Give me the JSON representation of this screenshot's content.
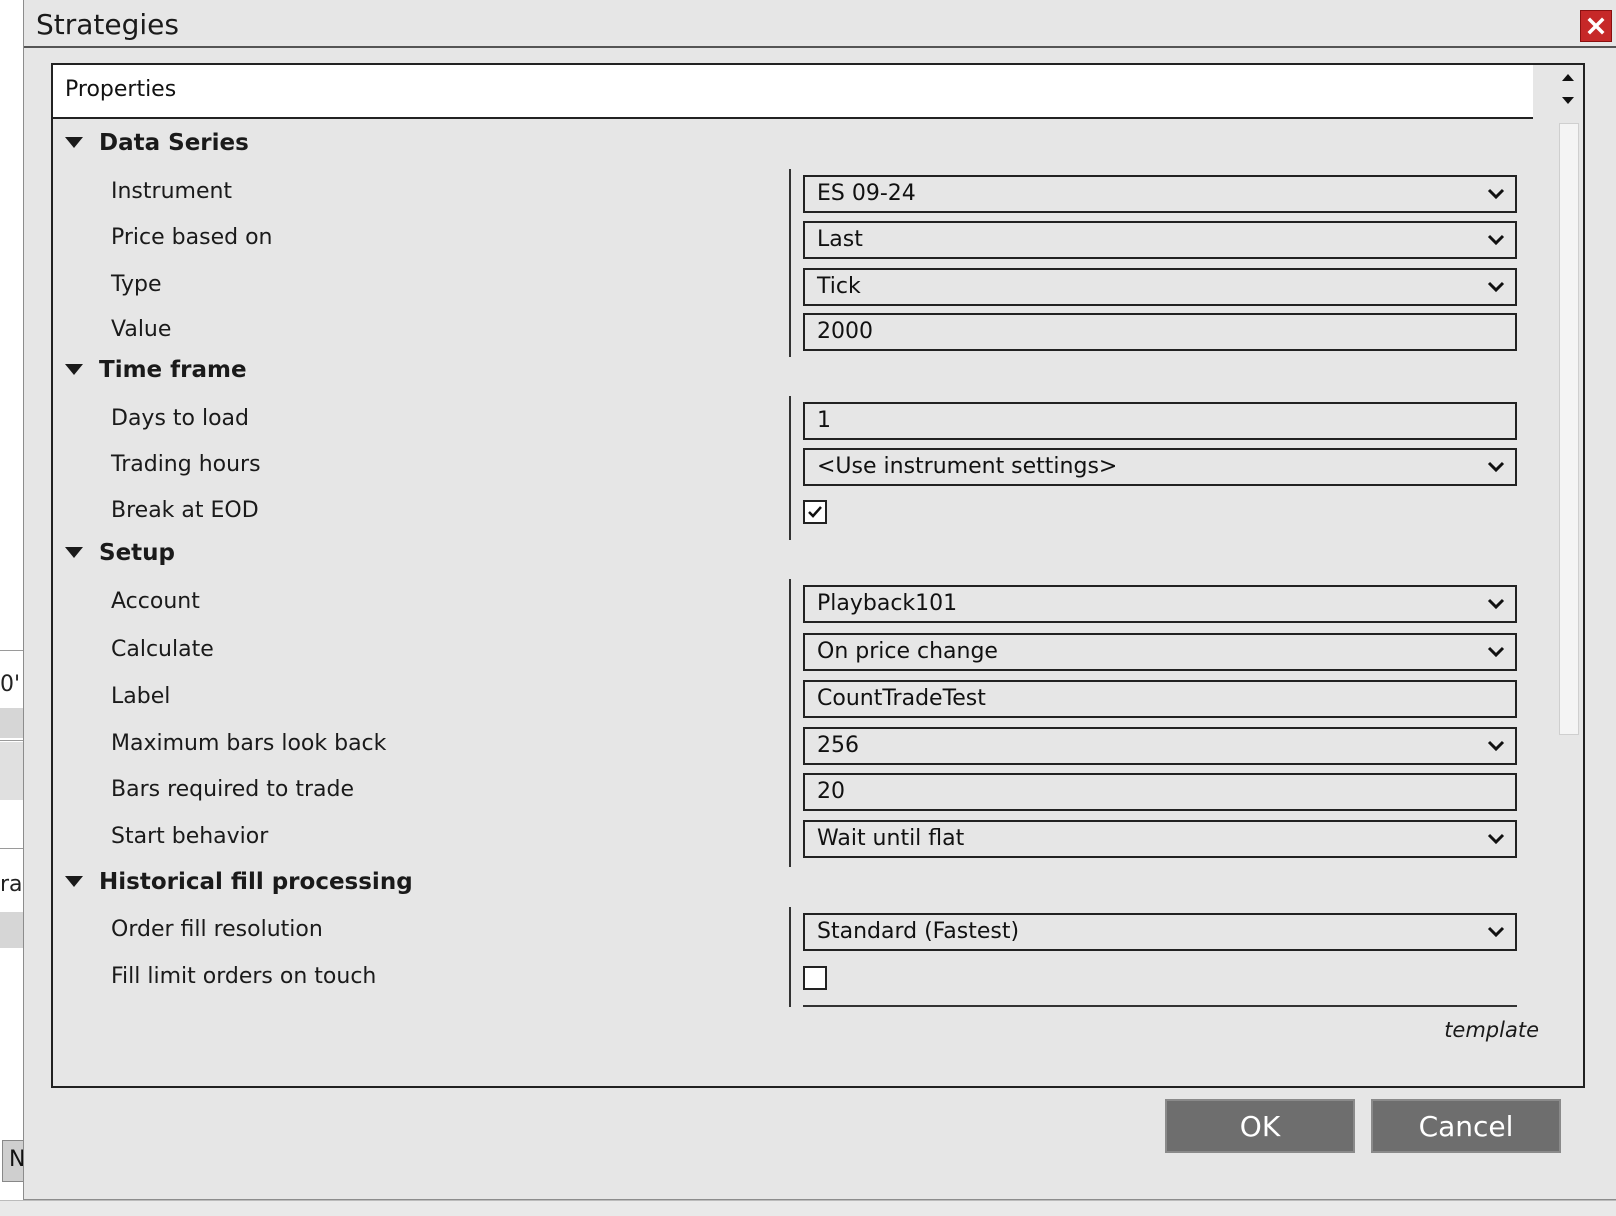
{
  "background": {
    "fragment_1": "0'",
    "fragment_2": "ra",
    "fragment_3": "N"
  },
  "dialog": {
    "title": "Strategies",
    "close_icon": "close-icon",
    "accent_close": "#c62828"
  },
  "properties": {
    "header": "Properties",
    "groups": [
      {
        "label": "Data Series",
        "items": [
          {
            "label": "Instrument",
            "type": "dropdown",
            "value": "ES 09-24"
          },
          {
            "label": "Price based on",
            "type": "dropdown",
            "value": "Last"
          },
          {
            "label": "Type",
            "type": "dropdown",
            "value": "Tick"
          },
          {
            "label": "Value",
            "type": "text",
            "value": "2000"
          }
        ]
      },
      {
        "label": "Time frame",
        "items": [
          {
            "label": "Days to load",
            "type": "text",
            "value": "1"
          },
          {
            "label": "Trading hours",
            "type": "dropdown",
            "value": "<Use instrument settings>"
          },
          {
            "label": "Break at EOD",
            "type": "checkbox",
            "checked": true
          }
        ]
      },
      {
        "label": "Setup",
        "items": [
          {
            "label": "Account",
            "type": "dropdown",
            "value": "Playback101"
          },
          {
            "label": "Calculate",
            "type": "dropdown",
            "value": "On price change"
          },
          {
            "label": "Label",
            "type": "text",
            "value": "CountTradeTest"
          },
          {
            "label": "Maximum bars look back",
            "type": "dropdown",
            "value": "256"
          },
          {
            "label": "Bars required to trade",
            "type": "text",
            "value": "20"
          },
          {
            "label": "Start behavior",
            "type": "dropdown",
            "value": "Wait until flat"
          }
        ]
      },
      {
        "label": "Historical fill processing",
        "items": [
          {
            "label": "Order fill resolution",
            "type": "dropdown",
            "value": "Standard (Fastest)"
          },
          {
            "label": "Fill limit orders on touch",
            "type": "checkbox",
            "checked": false
          }
        ]
      }
    ],
    "template_link": "template"
  },
  "buttons": {
    "ok": "OK",
    "cancel": "Cancel"
  }
}
